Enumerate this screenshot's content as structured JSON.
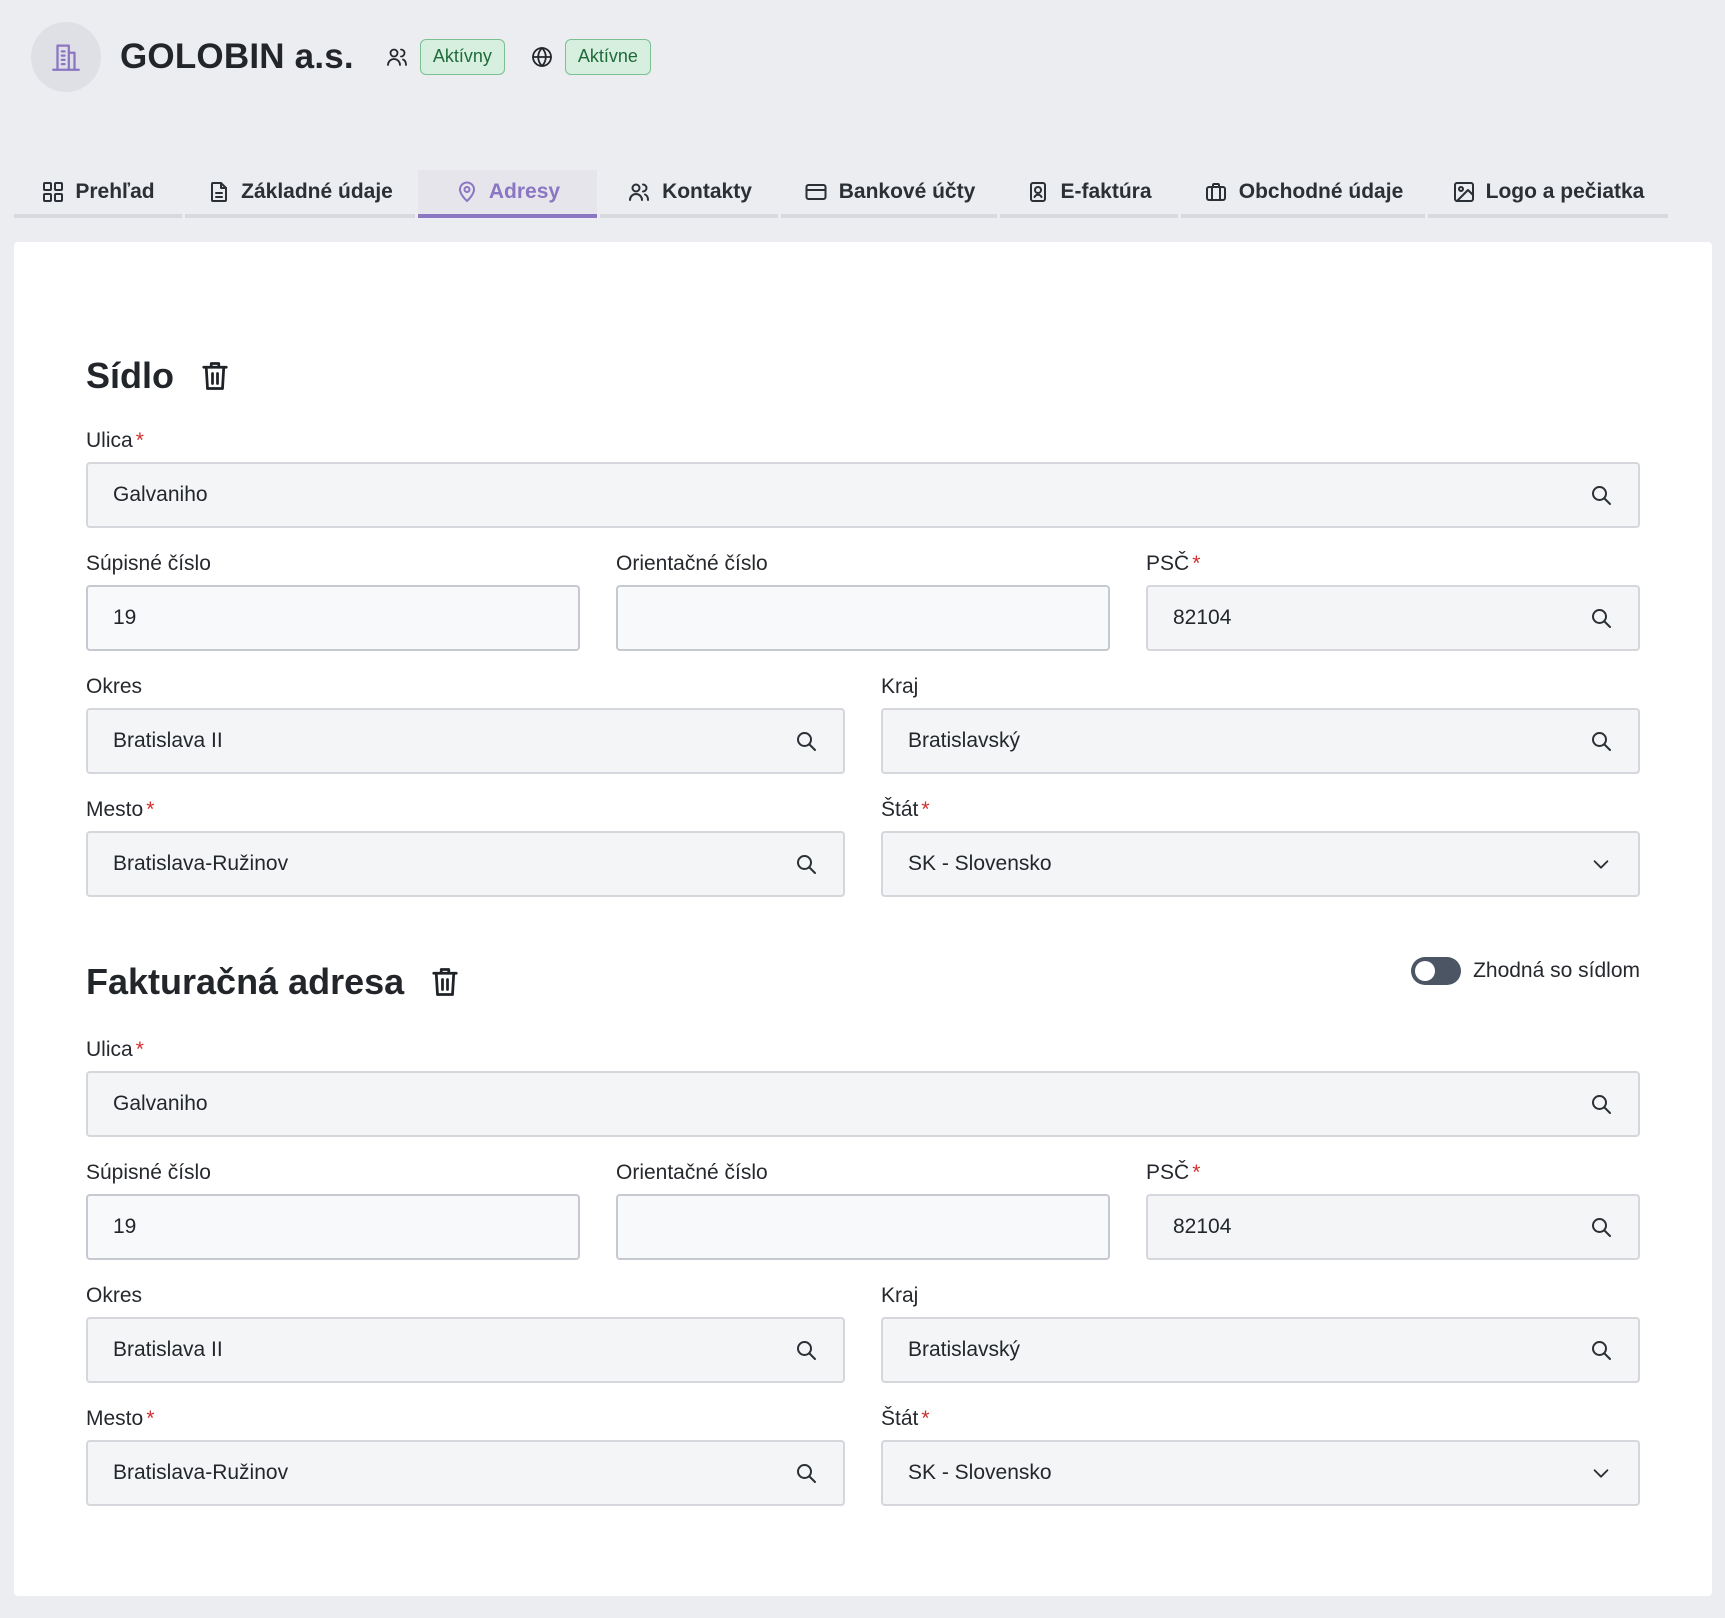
{
  "header": {
    "company_name": "GOLOBIN a.s.",
    "icon": "building-icon",
    "statuses": [
      {
        "icon": "users-icon",
        "label": "Aktívny"
      },
      {
        "icon": "globe-icon",
        "label": "Aktívne"
      }
    ]
  },
  "tabs": [
    {
      "label": "Prehľad",
      "icon": "dashboard-icon"
    },
    {
      "label": "Základné údaje",
      "icon": "document-icon"
    },
    {
      "label": "Adresy",
      "icon": "map-pin-icon",
      "active": true
    },
    {
      "label": "Kontakty",
      "icon": "users-icon"
    },
    {
      "label": "Bankové účty",
      "icon": "credit-card-icon"
    },
    {
      "label": "E-faktúra",
      "icon": "invoice-badge-icon"
    },
    {
      "label": "Obchodné údaje",
      "icon": "briefcase-icon"
    },
    {
      "label": "Logo a pečiatka",
      "icon": "image-icon"
    }
  ],
  "colors": {
    "accent": "#8a76c2",
    "badge_bg": "#d6efdf",
    "badge_text": "#1f6b3a",
    "required": "#d12f2f"
  },
  "sidlo": {
    "title": "Sídlo",
    "ulica": {
      "label": "Ulica",
      "value": "Galvaniho"
    },
    "supisne": {
      "label": "Súpisné číslo",
      "value": "19"
    },
    "orientacne": {
      "label": "Orientačné číslo",
      "value": ""
    },
    "psc": {
      "label": "PSČ",
      "value": "82104"
    },
    "okres": {
      "label": "Okres",
      "value": "Bratislava II"
    },
    "kraj": {
      "label": "Kraj",
      "value": "Bratislavský"
    },
    "mesto": {
      "label": "Mesto",
      "value": "Bratislava-Ružinov"
    },
    "stat": {
      "label": "Štát",
      "value": "SK - Slovensko"
    }
  },
  "fakturacna": {
    "title": "Fakturačná adresa",
    "same_toggle_label": "Zhodná so sídlom",
    "ulica": {
      "label": "Ulica",
      "value": "Galvaniho"
    },
    "supisne": {
      "label": "Súpisné číslo",
      "value": "19"
    },
    "orientacne": {
      "label": "Orientačné číslo",
      "value": ""
    },
    "psc": {
      "label": "PSČ",
      "value": "82104"
    },
    "okres": {
      "label": "Okres",
      "value": "Bratislava II"
    },
    "kraj": {
      "label": "Kraj",
      "value": "Bratislavský"
    },
    "mesto": {
      "label": "Mesto",
      "value": "Bratislava-Ružinov"
    },
    "stat": {
      "label": "Štát",
      "value": "SK - Slovensko"
    }
  }
}
